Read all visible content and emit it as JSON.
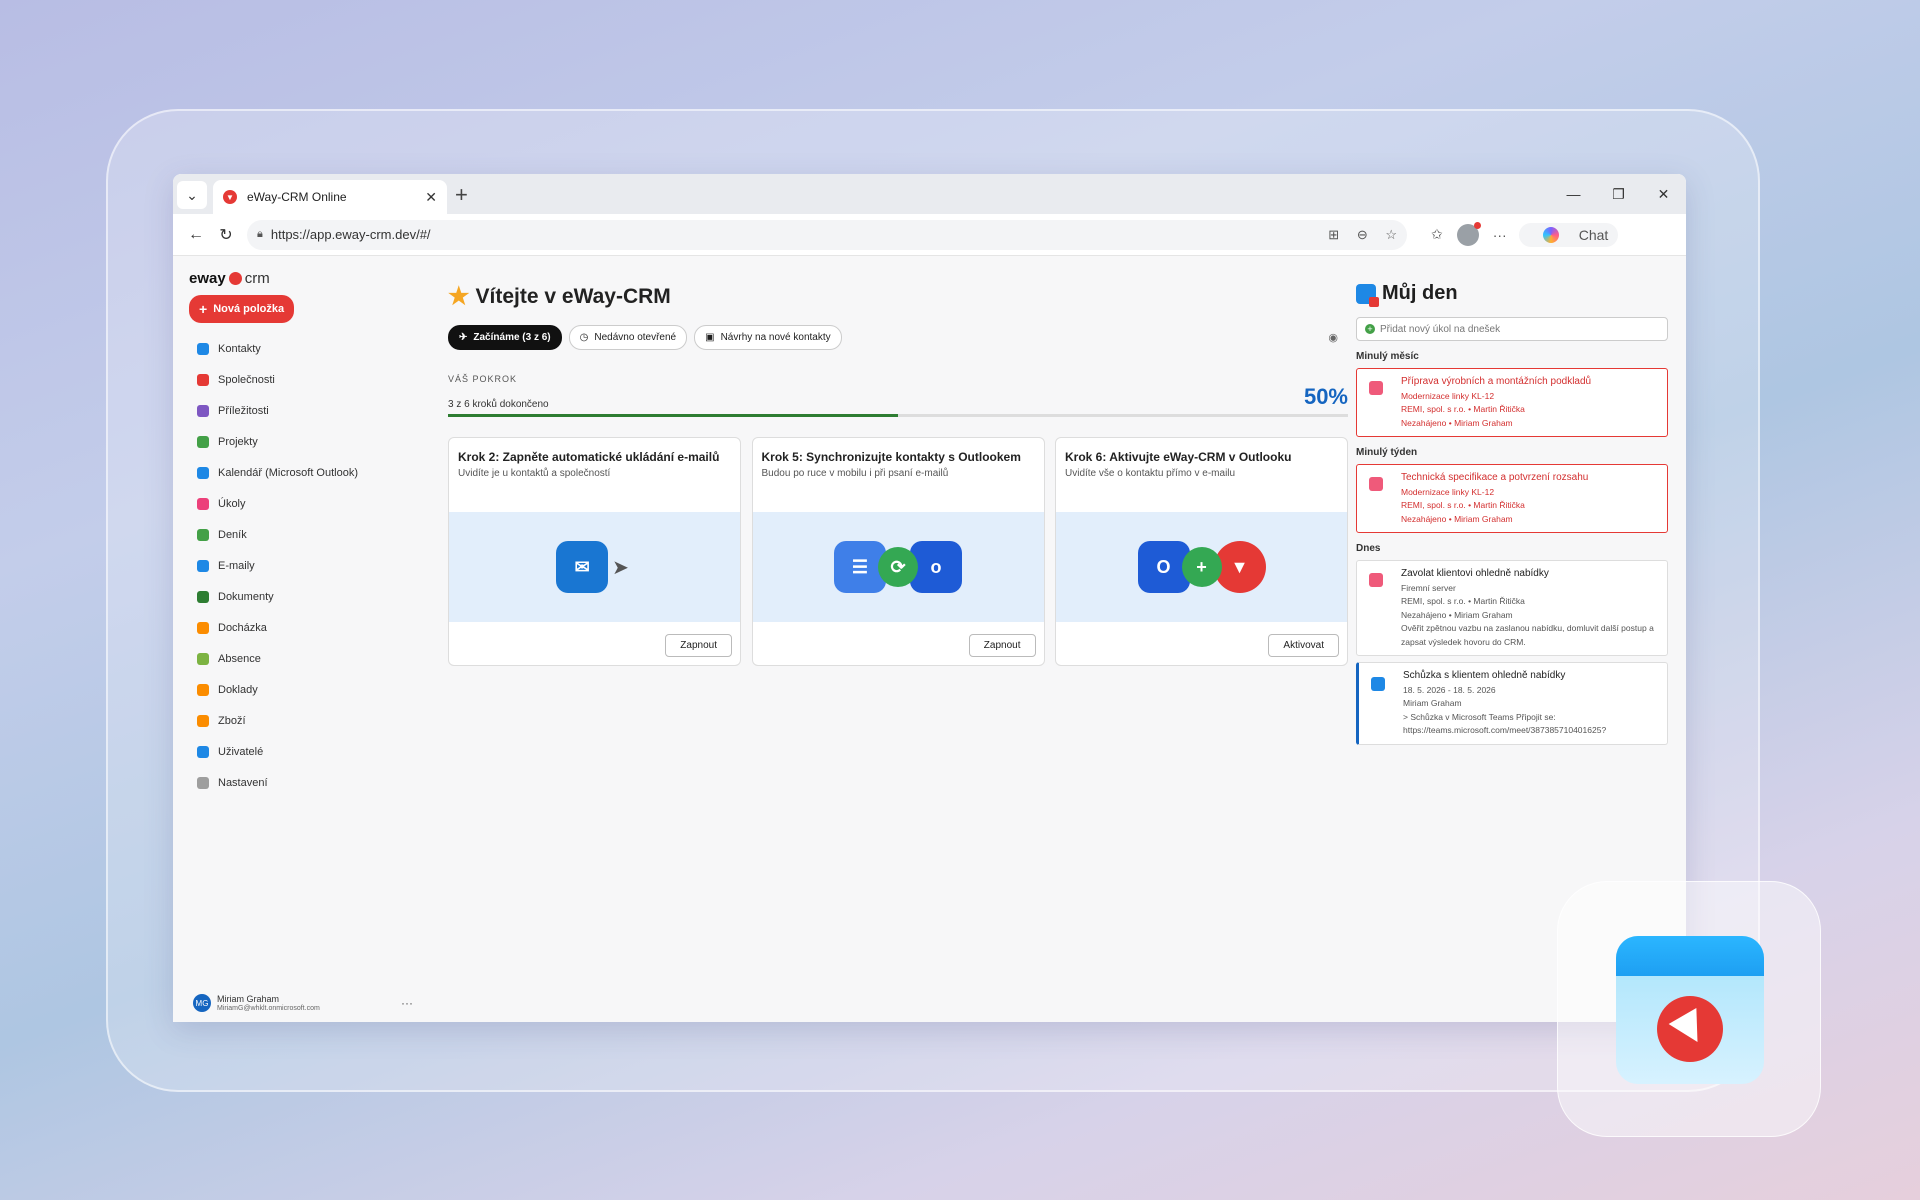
{
  "browser": {
    "tab_title": "eWay-CRM Online",
    "url": "https://app.eway-crm.dev/#/",
    "chat_label": "Chat"
  },
  "sidebar": {
    "logo": "eway",
    "logo_suffix": "crm",
    "new_item": "Nová položka",
    "items": [
      {
        "label": "Kontakty",
        "color": "#1e88e5"
      },
      {
        "label": "Společnosti",
        "color": "#e53935"
      },
      {
        "label": "Příležitosti",
        "color": "#7e57c2"
      },
      {
        "label": "Projekty",
        "color": "#43a047"
      },
      {
        "label": "Kalendář (Microsoft Outlook)",
        "color": "#1e88e5"
      },
      {
        "label": "Úkoly",
        "color": "#ec407a"
      },
      {
        "label": "Deník",
        "color": "#43a047"
      },
      {
        "label": "E-maily",
        "color": "#1e88e5"
      },
      {
        "label": "Dokumenty",
        "color": "#2e7d32"
      },
      {
        "label": "Docházka",
        "color": "#fb8c00"
      },
      {
        "label": "Absence",
        "color": "#7cb342"
      },
      {
        "label": "Doklady",
        "color": "#fb8c00"
      },
      {
        "label": "Zboží",
        "color": "#fb8c00"
      },
      {
        "label": "Uživatelé",
        "color": "#1e88e5"
      },
      {
        "label": "Nastavení",
        "color": "#9e9e9e"
      }
    ],
    "user": {
      "initials": "MG",
      "name": "Miriam Graham",
      "email": "MiriamG@whklt.onmicrosoft.com"
    }
  },
  "main": {
    "title": "Vítejte v eWay-CRM",
    "tabs": [
      "Začínáme (3 z 6)",
      "Nedávno otevřené",
      "Návrhy na nové kontakty"
    ],
    "progress_label": "VÁŠ POKROK",
    "progress_sub": "3 z 6 kroků dokončeno",
    "progress_pct": "50%",
    "progress_value": 0.5,
    "cards": [
      {
        "title": "Krok 2: Zapněte automatické ukládání e-mailů",
        "subtitle": "Uvidíte je u kontaktů a společností",
        "button": "Zapnout"
      },
      {
        "title": "Krok 5: Synchronizujte kontakty s Outlookem",
        "subtitle": "Budou po ruce v mobilu i při psaní e-mailů",
        "button": "Zapnout"
      },
      {
        "title": "Krok 6: Aktivujte eWay-CRM v Outlooku",
        "subtitle": "Uvidíte vše o kontaktu přímo v e-mailu",
        "button": "Aktivovat"
      }
    ]
  },
  "myday": {
    "title": "Můj den",
    "add_placeholder": "Přidat nový úkol na dnešek",
    "sections": [
      {
        "label": "Minulý měsíc",
        "tasks": [
          {
            "title": "Příprava výrobních a montážních podkladů",
            "lines": [
              "Modernizace linky KL-12",
              "REMI, spol. s r.o. • Martin Řitička",
              "Nezahájeno • Miriam Graham"
            ]
          }
        ]
      },
      {
        "label": "Minulý týden",
        "tasks": [
          {
            "title": "Technická specifikace a potvrzení rozsahu",
            "lines": [
              "Modernizace linky KL-12",
              "REMI, spol. s r.o. • Martin Řitička",
              "Nezahájeno • Miriam Graham"
            ]
          }
        ]
      },
      {
        "label": "Dnes",
        "tasks": [
          {
            "title": "Zavolat klientovi ohledně nabídky",
            "lines": [
              "Firemní server",
              "REMI, spol. s r.o. • Martin Řitička",
              "Nezahájeno • Miriam Graham",
              "Ověřit zpětnou vazbu na zaslanou nabídku, domluvit další postup a zapsat výsledek hovoru do CRM."
            ]
          },
          {
            "title": "Schůzka s klientem ohledně nabídky",
            "lines": [
              "18. 5. 2026 - 18. 5. 2026",
              "Miriam Graham",
              "> Schůzka v Microsoft Teams  Připojit se:",
              "https://teams.microsoft.com/meet/387385710401625?"
            ]
          }
        ]
      }
    ]
  }
}
